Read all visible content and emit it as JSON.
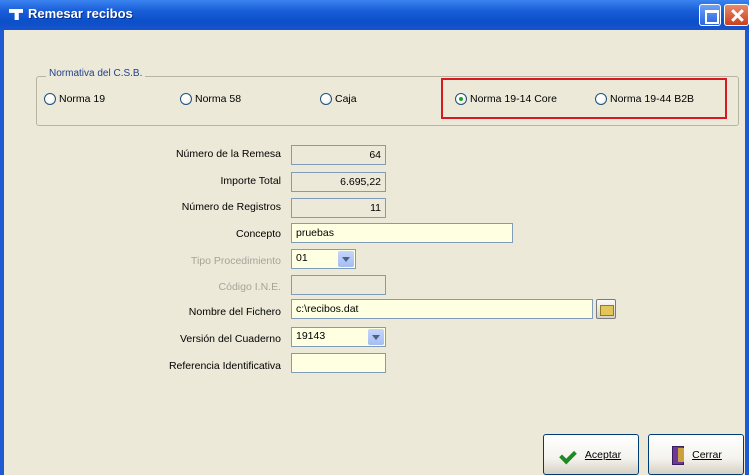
{
  "window": {
    "title": "Remesar recibos"
  },
  "normativa": {
    "group_label": "Normativa del C.S.B.",
    "options": [
      {
        "label": "Norma 19",
        "checked": false
      },
      {
        "label": "Norma 58",
        "checked": false
      },
      {
        "label": "Caja",
        "checked": false
      },
      {
        "label": "Norma 19-14 Core",
        "checked": true
      },
      {
        "label": "Norma 19-44 B2B",
        "checked": false
      }
    ]
  },
  "form": {
    "numero_remesa_label": "Número de la Remesa",
    "numero_remesa_value": "64",
    "importe_total_label": "Importe Total",
    "importe_total_value": "6.695,22",
    "numero_registros_label": "Número de Registros",
    "numero_registros_value": "11",
    "concepto_label": "Concepto",
    "concepto_value": "pruebas",
    "tipo_procedimiento_label": "Tipo Procedimiento",
    "tipo_procedimiento_value": "01",
    "codigo_ine_label": "Código I.N.E.",
    "codigo_ine_value": "",
    "nombre_fichero_label": "Nombre del Fichero",
    "nombre_fichero_value": "c:\\recibos.dat",
    "version_cuaderno_label": "Versión del Cuaderno",
    "version_cuaderno_value": "19143",
    "referencia_label": "Referencia Identificativa",
    "referencia_value": ""
  },
  "buttons": {
    "accept_label": "Aceptar",
    "close_label": "Cerrar"
  },
  "colors": {
    "titlebar": "#0b4fc9",
    "dialog_bg": "#ece9d8",
    "editable_bg": "#ffffe1",
    "highlight": "#d8191f"
  }
}
